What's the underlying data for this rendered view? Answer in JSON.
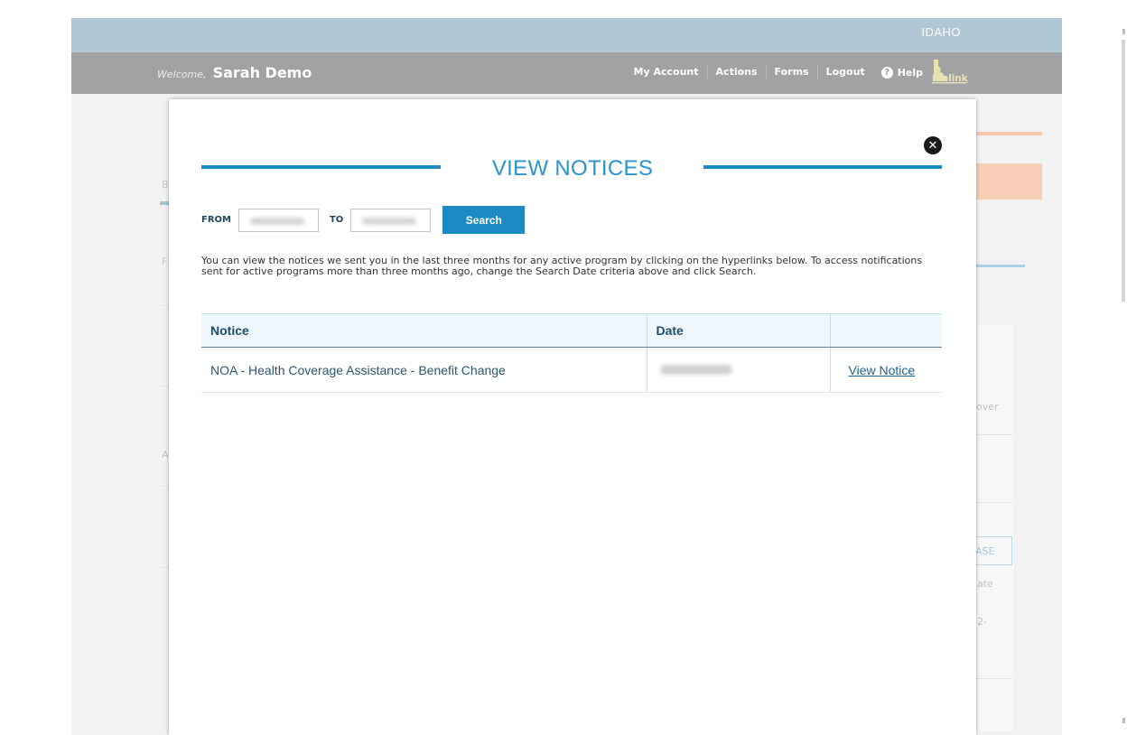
{
  "header": {
    "state_label": "IDAHO",
    "welcome_prefix": "Welcome,",
    "user_name": "Sarah Demo",
    "nav": [
      "My Account",
      "Actions",
      "Forms",
      "Logout"
    ],
    "help_label": "Help",
    "logo_text": "idalink"
  },
  "background": {
    "left_marks": [
      "B",
      "F",
      "A"
    ],
    "right_texts": [
      "over",
      "ASE",
      "ate",
      "2-"
    ]
  },
  "modal": {
    "title": "VIEW NOTICES",
    "close_label": "✕",
    "from_label": "FROM",
    "to_label": "TO",
    "search_label": "Search",
    "info_text": "You can view the notices we sent you in the last three months for any active program by clicking on the hyperlinks below. To access notifications sent for active programs more than three months ago, change the Search Date criteria above and click Search.",
    "table": {
      "columns": [
        "Notice",
        "Date",
        ""
      ],
      "rows": [
        {
          "notice": "NOA - Health Coverage Assistance - Benefit Change",
          "date_hidden": true,
          "action": "View Notice"
        }
      ]
    }
  },
  "colors": {
    "accent": "#1c8bc4",
    "header_state_bar": "#afc8d4",
    "header_nav_bar": "#a0a2a3",
    "title_blue": "#2a95cc"
  }
}
